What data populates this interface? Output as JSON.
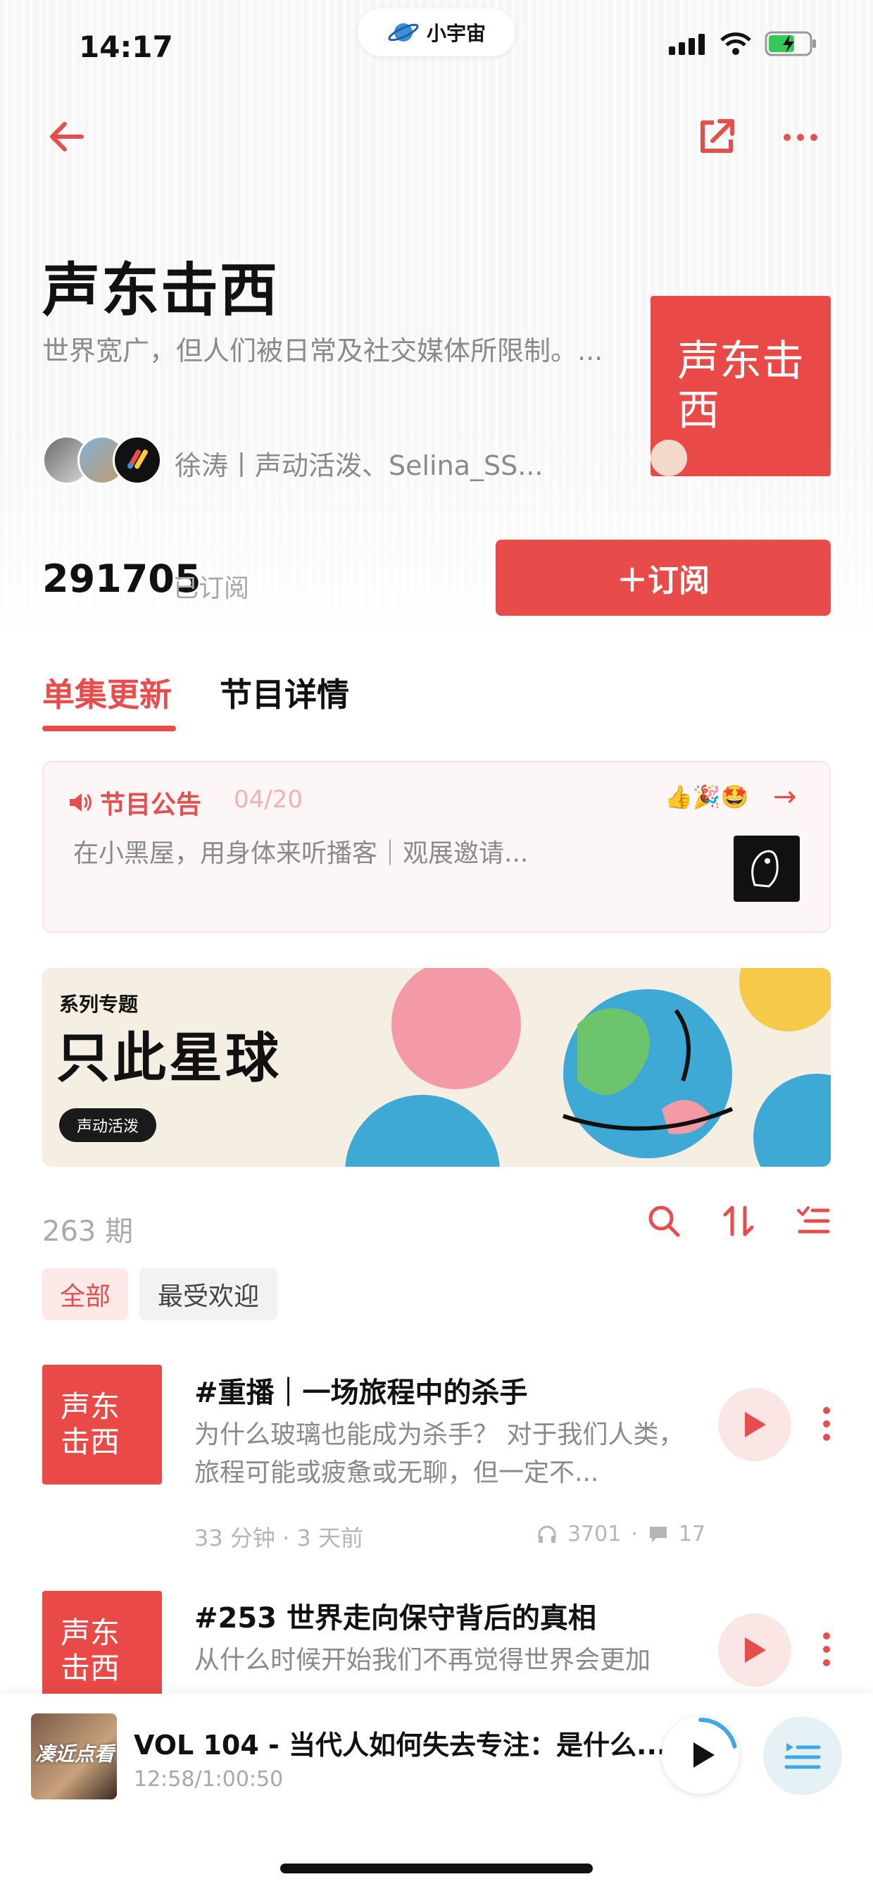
{
  "status_bar": {
    "time": "14:17",
    "app_pill": "小宇宙"
  },
  "podcast": {
    "title": "声东击西",
    "description": "世界宽广，但人们被日常及社交媒体所限制。...",
    "hosts": "徐涛丨声动活泼、Selina_SS...",
    "cover_text": "声东击西",
    "subscriber_count": "291705",
    "subscriber_label": "已订阅",
    "subscribe_button": "＋订阅"
  },
  "tabs": [
    {
      "label": "单集更新",
      "active": true
    },
    {
      "label": "节目详情",
      "active": false
    }
  ],
  "announcement": {
    "title": "节目公告",
    "date": "04/20",
    "text": "在小黑屋，用身体来听播客｜观展邀请...",
    "reactions": "👍🎉🤩"
  },
  "banner": {
    "small_label": "系列专题",
    "big_title": "只此星球",
    "badge": "声动活泼"
  },
  "episode_list": {
    "count_label": "263 期",
    "filters": [
      {
        "label": "全部",
        "active": true
      },
      {
        "label": "最受欢迎",
        "active": false
      }
    ],
    "episodes": [
      {
        "title": "#重播｜一场旅程中的杀手",
        "description": "为什么玻璃也能成为杀手？ 对于我们人类，旅程可能或疲惫或无聊，但一定不...",
        "meta": "33 分钟 · 3 天前",
        "plays": "3701",
        "comments": "17"
      },
      {
        "title": "#253 世界走向保守背后的真相",
        "description": "从什么时候开始我们不再觉得世界会更加"
      }
    ]
  },
  "player": {
    "cover_text": "凑近点看",
    "title": "VOL 104 - 当代人如何失去专注：是什么...",
    "time": "12:58/1:00:50",
    "progress": 0.21
  },
  "colors": {
    "accent": "#e84d4d",
    "cover": "#e94a48"
  }
}
